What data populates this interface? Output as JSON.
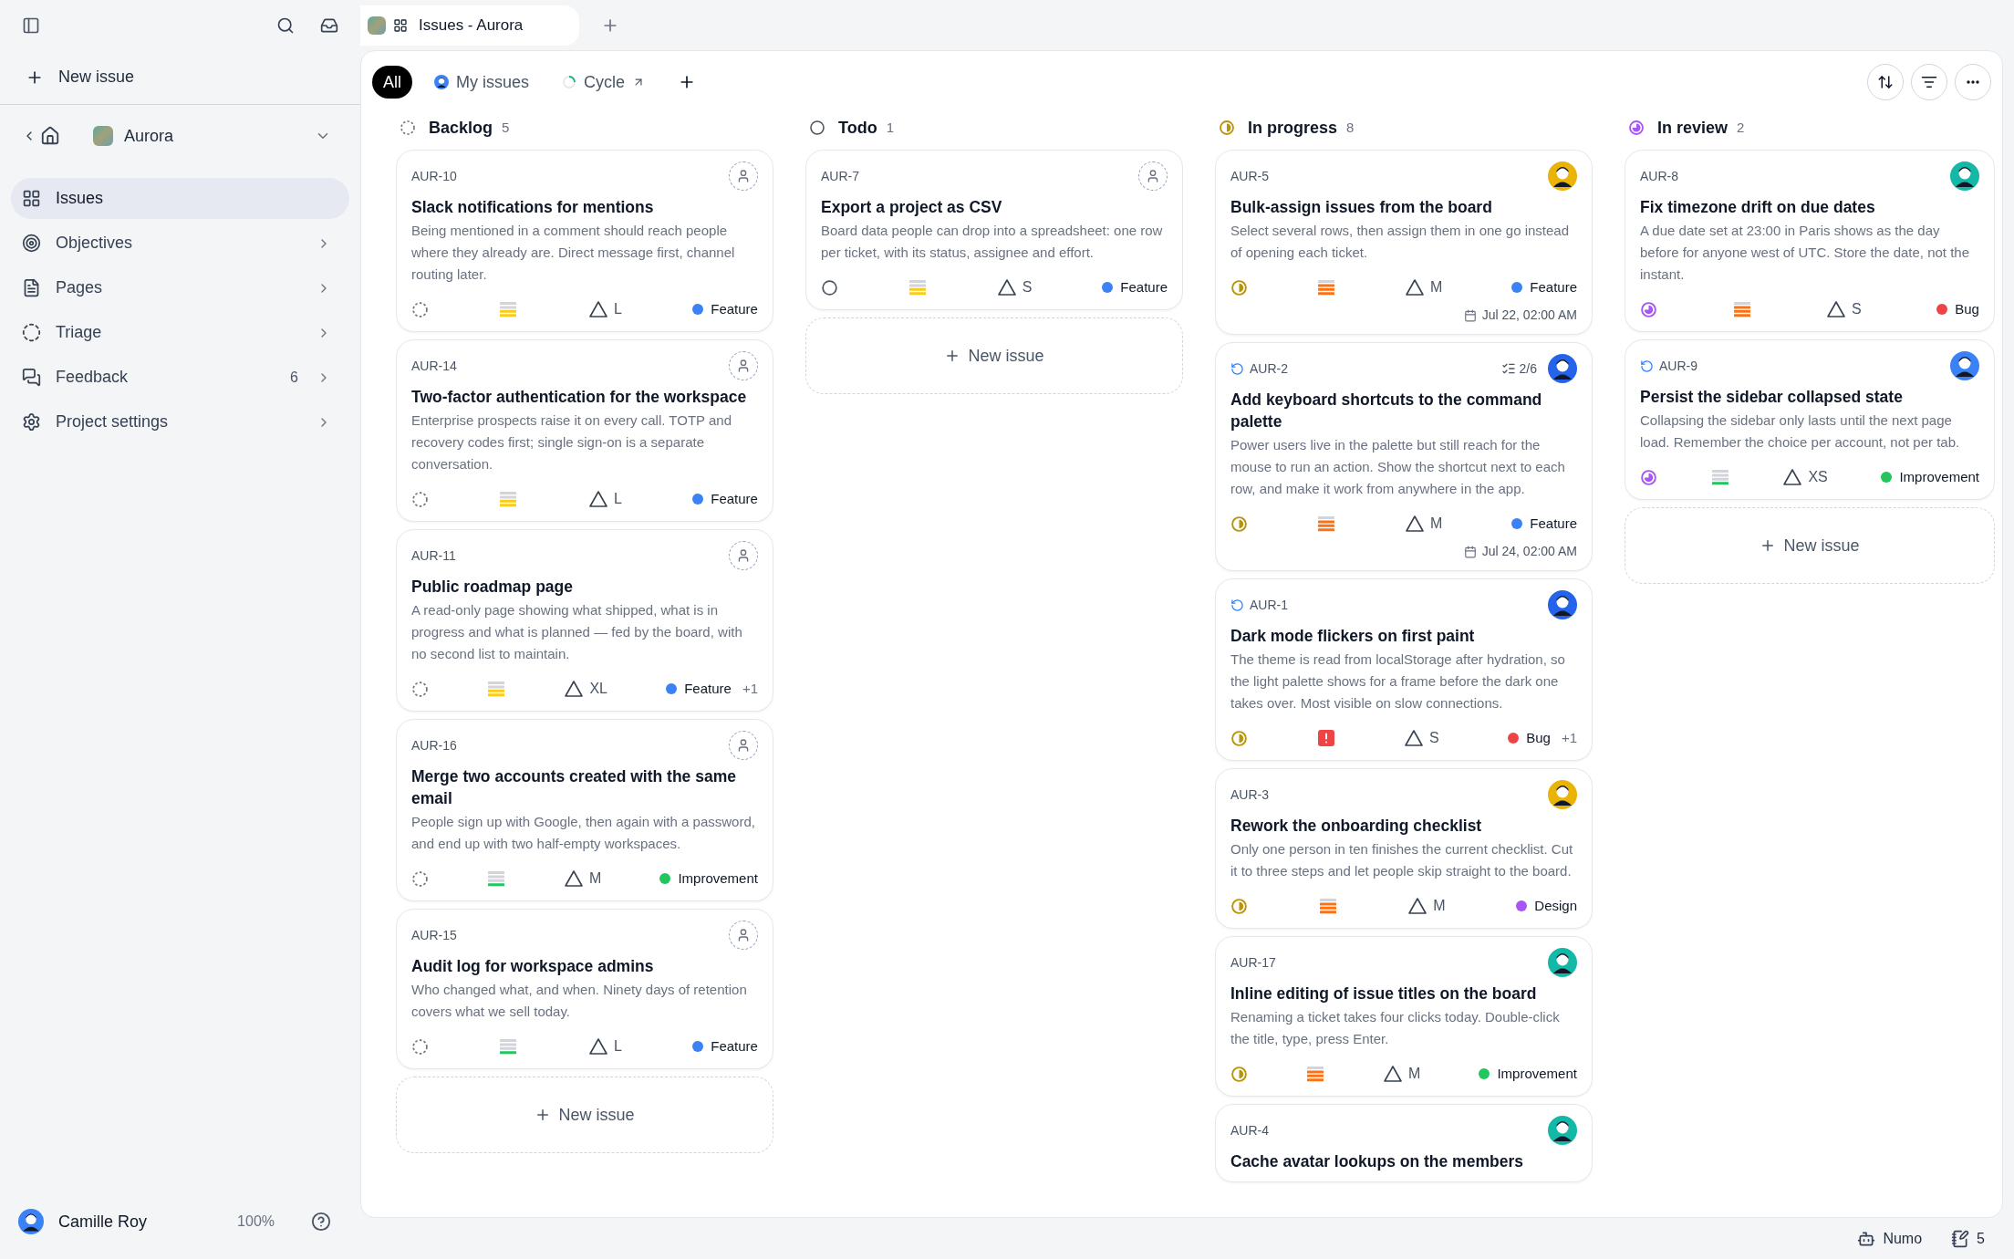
{
  "sidebar": {
    "new_issue": "New issue",
    "project": {
      "name": "Aurora"
    },
    "items": [
      {
        "label": "Issues",
        "kind": "grid",
        "selected": true,
        "expandable": false
      },
      {
        "label": "Objectives",
        "kind": "target",
        "selected": false,
        "expandable": true
      },
      {
        "label": "Pages",
        "kind": "page",
        "selected": false,
        "expandable": true
      },
      {
        "label": "Triage",
        "kind": "triage",
        "selected": false,
        "expandable": true
      },
      {
        "label": "Feedback",
        "kind": "feedback",
        "selected": false,
        "expandable": true,
        "count": "6"
      },
      {
        "label": "Project settings",
        "kind": "settings",
        "selected": false,
        "expandable": true
      }
    ],
    "user": {
      "name": "Camille Roy",
      "color": "#3b82f6"
    },
    "zoom": "100%"
  },
  "window_tab": {
    "title": "Issues - Aurora"
  },
  "view_tabs": [
    {
      "label": "All",
      "kind": "plain",
      "selected": true
    },
    {
      "label": "My issues",
      "kind": "avatar",
      "selected": false
    },
    {
      "label": "Cycle",
      "kind": "cycle",
      "selected": false
    }
  ],
  "columns": [
    {
      "name": "Backlog",
      "kind": "backlog",
      "count": "5",
      "new_issue": "New issue",
      "cards": [
        {
          "id": "AUR-10",
          "title": "Slack notifications for mentions",
          "description": "Being mentioned in a comment should reach people where they already are. Direct message first, channel routing later.",
          "priority": {
            "kind": "low"
          },
          "size": "L",
          "labels": [
            {
              "name": "Feature",
              "color": "#3b82f6"
            }
          ]
        },
        {
          "id": "AUR-14",
          "title": "Two-factor authentication for the workspace",
          "description": "Enterprise prospects raise it on every call. TOTP and recovery codes first; single sign-on is a separate conversation.",
          "priority": {
            "kind": "low"
          },
          "size": "L",
          "labels": [
            {
              "name": "Feature",
              "color": "#3b82f6"
            }
          ]
        },
        {
          "id": "AUR-11",
          "title": "Public roadmap page",
          "description": "A read-only page showing what shipped, what is in progress and what is planned — fed by the board, with no second list to maintain.",
          "priority": {
            "kind": "low"
          },
          "size": "XL",
          "labels": [
            {
              "name": "Feature",
              "color": "#3b82f6"
            }
          ],
          "more_labels": "+1"
        },
        {
          "id": "AUR-16",
          "title": "Merge two accounts created with the same email",
          "description": "People sign up with Google, then again with a password, and end up with two half-empty workspaces.",
          "priority": {
            "kind": "minor"
          },
          "size": "M",
          "labels": [
            {
              "name": "Improvement",
              "color": "#22c55e"
            }
          ]
        },
        {
          "id": "AUR-15",
          "title": "Audit log for workspace admins",
          "description": "Who changed what, and when. Ninety days of retention covers what we sell today.",
          "priority": {
            "kind": "minor"
          },
          "size": "L",
          "labels": [
            {
              "name": "Feature",
              "color": "#3b82f6"
            }
          ]
        }
      ]
    },
    {
      "name": "Todo",
      "kind": "todo",
      "count": "1",
      "new_issue": "New issue",
      "cards": [
        {
          "id": "AUR-7",
          "title": "Export a project as CSV",
          "description": "Board data people can drop into a spreadsheet: one row per ticket, with its status, assignee and effort.",
          "priority": {
            "kind": "low"
          },
          "size": "S",
          "labels": [
            {
              "name": "Feature",
              "color": "#3b82f6"
            }
          ]
        }
      ]
    },
    {
      "name": "In progress",
      "kind": "in_progress",
      "count": "8",
      "cards": [
        {
          "id": "AUR-5",
          "assignee": {
            "color": "#eab308"
          },
          "title": "Bulk-assign issues from the board",
          "description": "Select several rows, then assign them in one go instead of opening each ticket.",
          "priority": {
            "kind": "high"
          },
          "size": "M",
          "labels": [
            {
              "name": "Feature",
              "color": "#3b82f6"
            }
          ],
          "due": "Jul 22, 02:00 AM"
        },
        {
          "id": "AUR-2",
          "synced": true,
          "subtasks": "2/6",
          "assignee": {
            "color": "#2563eb"
          },
          "title": "Add keyboard shortcuts to the command palette",
          "description": "Power users live in the palette but still reach for the mouse to run an action. Show the shortcut next to each row, and make it work from anywhere in the app.",
          "priority": {
            "kind": "high"
          },
          "size": "M",
          "labels": [
            {
              "name": "Feature",
              "color": "#3b82f6"
            }
          ],
          "due": "Jul 24, 02:00 AM"
        },
        {
          "id": "AUR-1",
          "synced": true,
          "assignee": {
            "color": "#2563eb"
          },
          "title": "Dark mode flickers on first paint",
          "description": "The theme is read from localStorage after hydration, so the light palette shows for a frame before the dark one takes over. Most visible on slow connections.",
          "priority": {
            "kind": "urgent"
          },
          "size": "S",
          "labels": [
            {
              "name": "Bug",
              "color": "#ef4444"
            }
          ],
          "more_labels": "+1"
        },
        {
          "id": "AUR-3",
          "assignee": {
            "color": "#eab308"
          },
          "title": "Rework the onboarding checklist",
          "description": "Only one person in ten finishes the current checklist. Cut it to three steps and let people skip straight to the board.",
          "priority": {
            "kind": "high"
          },
          "size": "M",
          "labels": [
            {
              "name": "Design",
              "color": "#a855f7"
            }
          ]
        },
        {
          "id": "AUR-17",
          "assignee": {
            "color": "#14b8a6"
          },
          "title": "Inline editing of issue titles on the board",
          "description": "Renaming a ticket takes four clicks today. Double-click the title, type, press Enter.",
          "priority": {
            "kind": "high"
          },
          "size": "M",
          "labels": [
            {
              "name": "Improvement",
              "color": "#22c55e"
            }
          ]
        },
        {
          "id": "AUR-4",
          "assignee": {
            "color": "#14b8a6"
          },
          "title": "Cache avatar lookups on the members"
        }
      ]
    },
    {
      "name": "In review",
      "kind": "in_review",
      "count": "2",
      "new_issue": "New issue",
      "cards": [
        {
          "id": "AUR-8",
          "assignee": {
            "color": "#14b8a6"
          },
          "title": "Fix timezone drift on due dates",
          "description": "A due date set at 23:00 in Paris shows as the day before for anyone west of UTC. Store the date, not the instant.",
          "priority": {
            "kind": "high"
          },
          "size": "S",
          "labels": [
            {
              "name": "Bug",
              "color": "#ef4444"
            }
          ]
        },
        {
          "id": "AUR-9",
          "synced": true,
          "assignee": {
            "color": "#3b82f6"
          },
          "title": "Persist the sidebar collapsed state",
          "description": "Collapsing the sidebar only lasts until the next page load. Remember the choice per account, not per tab.",
          "priority": {
            "kind": "minor"
          },
          "size": "XS",
          "labels": [
            {
              "name": "Improvement",
              "color": "#22c55e"
            }
          ]
        }
      ]
    }
  ],
  "status_bar": {
    "assistant": "Numo",
    "notes": "5"
  }
}
